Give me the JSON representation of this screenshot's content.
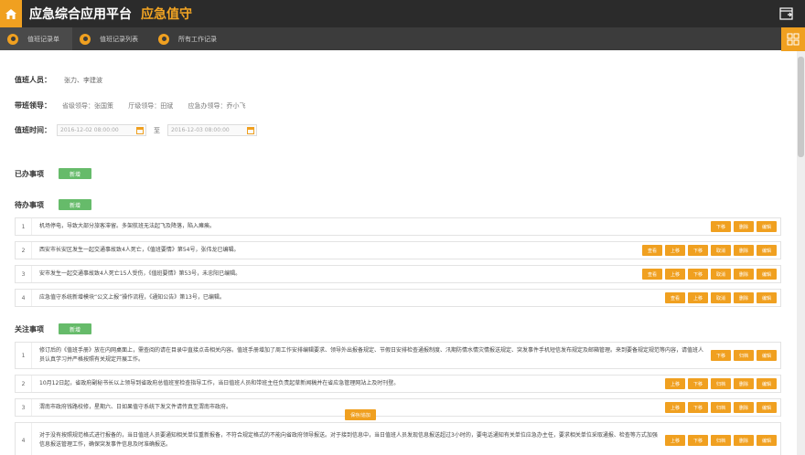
{
  "header": {
    "title": "应急综合应用平台",
    "subtitle": "应急值守"
  },
  "tabs": [
    {
      "label": "值班记录单"
    },
    {
      "label": "值班记录列表"
    },
    {
      "label": "所有工作记录"
    }
  ],
  "duty": {
    "personnel_label": "值班人员：",
    "personnel_value": "张力、李建波",
    "leaders_label": "带班领导：",
    "leaders": [
      "省级领导：张国策",
      "厅级领导：田斌",
      "应急办领导：乔小飞"
    ],
    "time_label": "值班时间：",
    "start": "2016-12-02 08:00:00",
    "to": "至",
    "end": "2016-12-03 08:00:00"
  },
  "sections": {
    "done_label": "已办事项",
    "todo_label": "待办事项",
    "focus_label": "关注事项",
    "add_label": "新增"
  },
  "todo_items": [
    {
      "num": "1",
      "text": "机场停电，导致大部分旅客滞留。多架航班无法起飞及降落，陷入瘫痪。",
      "buttons": [
        "下移",
        "删除",
        "编辑"
      ]
    },
    {
      "num": "2",
      "text": "西安市长安区发生一起交通事故致4人死亡，《值班要情》第54号，张伟龙已编辑。",
      "buttons": [
        "查看",
        "上移",
        "下移",
        "取消",
        "删除",
        "编辑"
      ]
    },
    {
      "num": "3",
      "text": "安市发生一起交通事故致4人死亡15人受伤，《值班要情》第53号，未忠阳已编辑。",
      "buttons": [
        "查看",
        "上移",
        "下移",
        "取消",
        "删除",
        "编辑"
      ]
    },
    {
      "num": "4",
      "text": "应急值守系统新增模块“公文上报”操作流程，《通知公告》第13号，已编辑。",
      "buttons": [
        "查看",
        "上移",
        "取消",
        "删除",
        "编辑"
      ]
    }
  ],
  "focus_items": [
    {
      "num": "1",
      "text": "修订后的《值班手册》放在内网桌面上，需查阅的请在目录中直接点击相关内容。值班手册增加了周工作安排编辑要求、领导外出报备规定、节假日安排检查通报制度、汛期防情水情灾情报送规定、突发事件手机短信发布规定及邮箱管理。来到要备规定规范等内容，请值班人员认真学习并严格按照有关规定开展工作。",
      "buttons": [
        "下移",
        "归档",
        "编辑"
      ]
    },
    {
      "num": "2",
      "text": "10月12日起，省政府副秘书长以上领导到省政府总值班室检查指导工作，当日值班人员和带班主任负责起草新闻稿并在省应急管理网站上及时刊登。",
      "buttons": [
        "上移",
        "下移",
        "归档",
        "删除",
        "编辑"
      ]
    },
    {
      "num": "3",
      "text": "渭南市政府钱路校修，星期六、日如果值守系统下发文件请传真至渭南市政府。",
      "buttons": [
        "上移",
        "下移",
        "归档",
        "删除",
        "编辑"
      ]
    },
    {
      "num": "4",
      "text": "对于没有按照规范格式进行报备的，当日值班人员要通知相关单位重新报备，不符合规定格式的不能向省政府领导报送。对于接到信息中，当日值班人员发现信息报送超过3小时的，要电话通知有关单位应急办主任，要求相关单位采取通报、检查等方式加强信息报送管理工作，确保突发事件信息及时准确报送。",
      "buttons": [
        "上移",
        "下移",
        "归档",
        "删除",
        "编辑"
      ]
    }
  ],
  "save_label": "保存/追加",
  "colors": {
    "accent": "#f0a020",
    "green": "#66bb6a",
    "topbar": "#2b2b2b"
  }
}
